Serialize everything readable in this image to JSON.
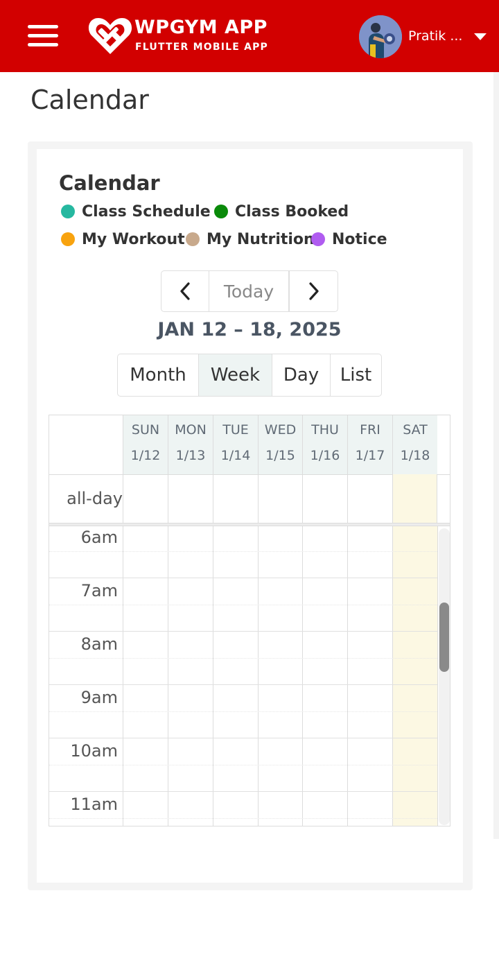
{
  "header": {
    "menu_icon": "hamburger-menu-icon",
    "logo_icon": "heart-dumbbell-logo-icon",
    "app_title": "WPGYM APP",
    "app_subtitle": "FLUTTER MOBILE APP",
    "user_name": "Pratik ...",
    "user_menu_icon": "caret-down-icon",
    "brand_color": "#d20000"
  },
  "page": {
    "title": "Calendar"
  },
  "calendar": {
    "title": "Calendar",
    "legend": [
      {
        "label": "Class Schedule",
        "color": "#26b8a0"
      },
      {
        "label": "Class Booked",
        "color": "#0a8a0a"
      },
      {
        "label": "My Workout",
        "color": "#f8a30f"
      },
      {
        "label": "My Nutrition",
        "color": "#c8a98c"
      },
      {
        "label": "Notice",
        "color": "#b05cf0"
      }
    ],
    "nav": {
      "prev_icon": "chevron-left-icon",
      "today_label": "Today",
      "next_icon": "chevron-right-icon"
    },
    "range_title": "JAN 12 – 18, 2025",
    "views": [
      {
        "label": "Month",
        "active": false
      },
      {
        "label": "Week",
        "active": true
      },
      {
        "label": "Day",
        "active": false
      },
      {
        "label": "List",
        "active": false
      }
    ],
    "days": [
      {
        "name": "SUN",
        "date": "1/12",
        "today": false
      },
      {
        "name": "MON",
        "date": "1/13",
        "today": false
      },
      {
        "name": "TUE",
        "date": "1/14",
        "today": false
      },
      {
        "name": "WED",
        "date": "1/15",
        "today": false
      },
      {
        "name": "THU",
        "date": "1/16",
        "today": false
      },
      {
        "name": "FRI",
        "date": "1/17",
        "today": false
      },
      {
        "name": "SAT",
        "date": "1/18",
        "today": true
      }
    ],
    "all_day_label": "all-day",
    "times": [
      "6am",
      "7am",
      "8am",
      "9am",
      "10am",
      "11am"
    ],
    "today_color": "#fcf8e3"
  }
}
